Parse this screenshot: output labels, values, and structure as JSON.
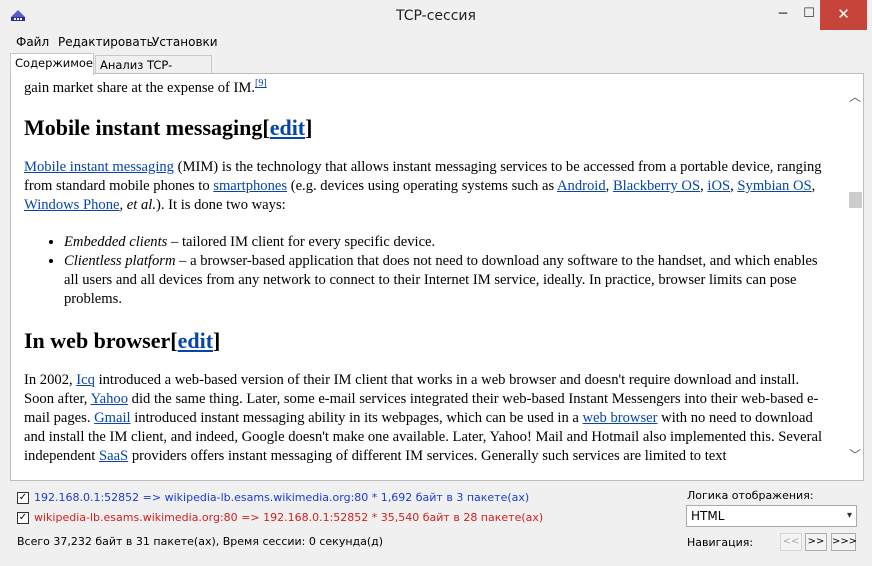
{
  "window": {
    "title": "TCP-сессия",
    "minimize_glyph": "─",
    "maximize_glyph": "☐",
    "close_glyph": "✕"
  },
  "menu": {
    "items": [
      "Файл",
      "Редактировать",
      "Установки"
    ]
  },
  "tabs": {
    "content": "Содержимое",
    "analysis": "Анализ TCP-сессии"
  },
  "document": {
    "intro_tail": "gain market share at the expense of IM.",
    "intro_ref": "[9]",
    "section1": {
      "title": "Mobile instant messaging",
      "edit_open": "[",
      "edit_link": "edit",
      "edit_close": "]",
      "p_link_mim": "Mobile instant messaging",
      "p_text_1": " (MIM) is the technology that allows instant messaging services to be accessed from a portable device, ranging from standard mobile phones to ",
      "p_link_smartphones": "smartphones",
      "p_text_2": " (e.g. devices using operating systems such as ",
      "p_link_android": "Android",
      "comma": ", ",
      "p_link_blackberry": "Blackberry OS",
      "p_link_ios": "iOS",
      "p_link_symbian": "Symbian OS",
      "p_link_windowsphone": "Windows Phone",
      "p_etal": "et al.",
      "p_text_3": "). It is done two ways:",
      "bullet1_em": "Embedded clients",
      "bullet1_text": " – tailored IM client for every specific device.",
      "bullet2_em": "Clientless platform",
      "bullet2_text": " – a browser-based application that does not need to download any software to the handset, and which enables all users and all devices from any network to connect to their Internet IM service, ideally. In practice, browser limits can pose problems."
    },
    "section2": {
      "title": "In web browser",
      "edit_open": "[",
      "edit_link": "edit",
      "edit_close": "]",
      "t1": "In 2002, ",
      "l_icq": "Icq",
      "t2": " introduced a web-based version of their IM client that works in a web browser and doesn't require download and install. Soon after, ",
      "l_yahoo": "Yahoo",
      "t3": " did the same thing. Later, some e-mail services integrated their web-based Instant Messengers into their web-based e-mail pages. ",
      "l_gmail": "Gmail",
      "t4": " introduced instant messaging ability in its webpages, which can be used in a ",
      "l_webbrowser": "web browser",
      "t5": " with no need to download and install the IM client, and indeed, Google doesn't make one available. Later, Yahoo! Mail and Hotmail also implemented this. Several independent ",
      "l_saas": "SaaS",
      "t6": " providers offers instant messaging of different IM services. Generally such services are limited to text"
    }
  },
  "streams": {
    "client": "192.168.0.1:52852 => wikipedia-lb.esams.wikimedia.org:80 * 1,692 байт в 3 пакете(ах)",
    "server": "wikipedia-lb.esams.wikimedia.org:80 => 192.168.0.1:52852 * 35,540 байт в 28 пакете(ах)",
    "checkmark": "✓",
    "summary": "Всего 37,232 байт в 31 пакете(ах), Время сессии: 0 секунда(д)"
  },
  "display": {
    "label": "Логика отображения:",
    "selected": "HTML",
    "arrow": "▾"
  },
  "navigation": {
    "label": "Навигация:",
    "prev": "<<",
    "next": ">>",
    "last": ">>>"
  },
  "scrollbar": {
    "up": "︿",
    "down": "﹀"
  },
  "colors": {
    "client_stream": "#1a3bd6",
    "server_stream": "#d22020",
    "link": "#0645ad",
    "close_button": "#c7443b"
  }
}
